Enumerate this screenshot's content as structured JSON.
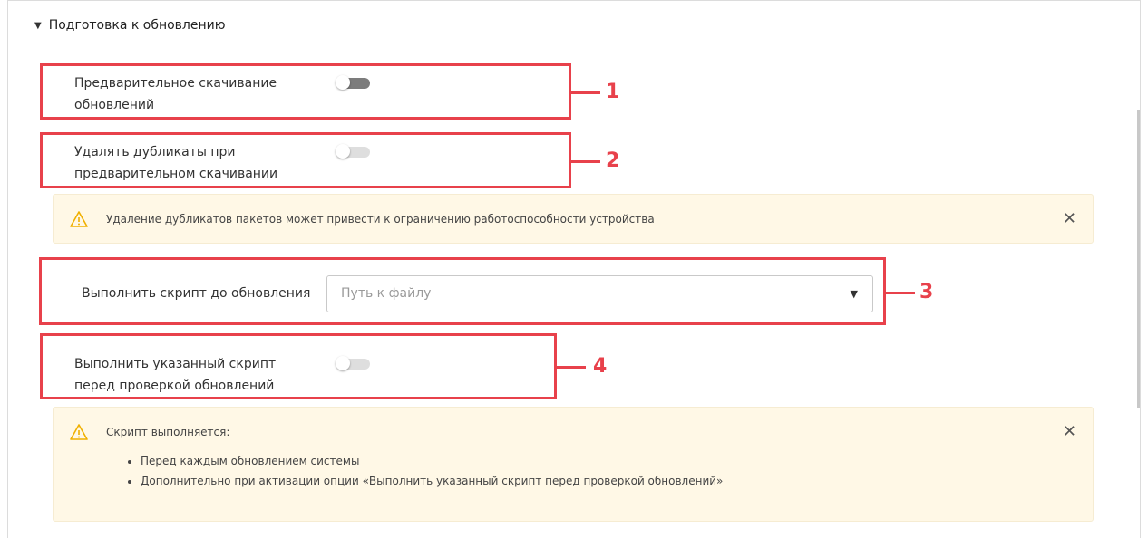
{
  "section": {
    "title": "Подготовка к обновлению"
  },
  "options": [
    {
      "label_line1": "Предварительное скачивание",
      "label_line2": "обновлений",
      "enabled": true
    },
    {
      "label_line1": "Удалять дубликаты при",
      "label_line2": "предварительном скачивании",
      "enabled": false
    },
    {
      "label": "Выполнить скрипт до обновления",
      "placeholder": "Путь к файлу"
    },
    {
      "label_line1": "Выполнить указанный скрипт",
      "label_line2": "перед проверкой обновлений",
      "enabled": false
    }
  ],
  "warning1": {
    "text": "Удаление дубликатов пакетов может привести к ограничению работоспособности устройства"
  },
  "warning2": {
    "title": "Скрипт выполняется:",
    "items": [
      "Перед каждым обновлением системы",
      "Дополнительно при активации опции «Выполнить указанный скрипт перед проверкой обновлений»"
    ]
  },
  "callouts": [
    "1",
    "2",
    "3",
    "4"
  ],
  "colors": {
    "annotation": "#e8414b",
    "warning_bg": "#fff8e6",
    "warning_icon": "#f0b000"
  }
}
